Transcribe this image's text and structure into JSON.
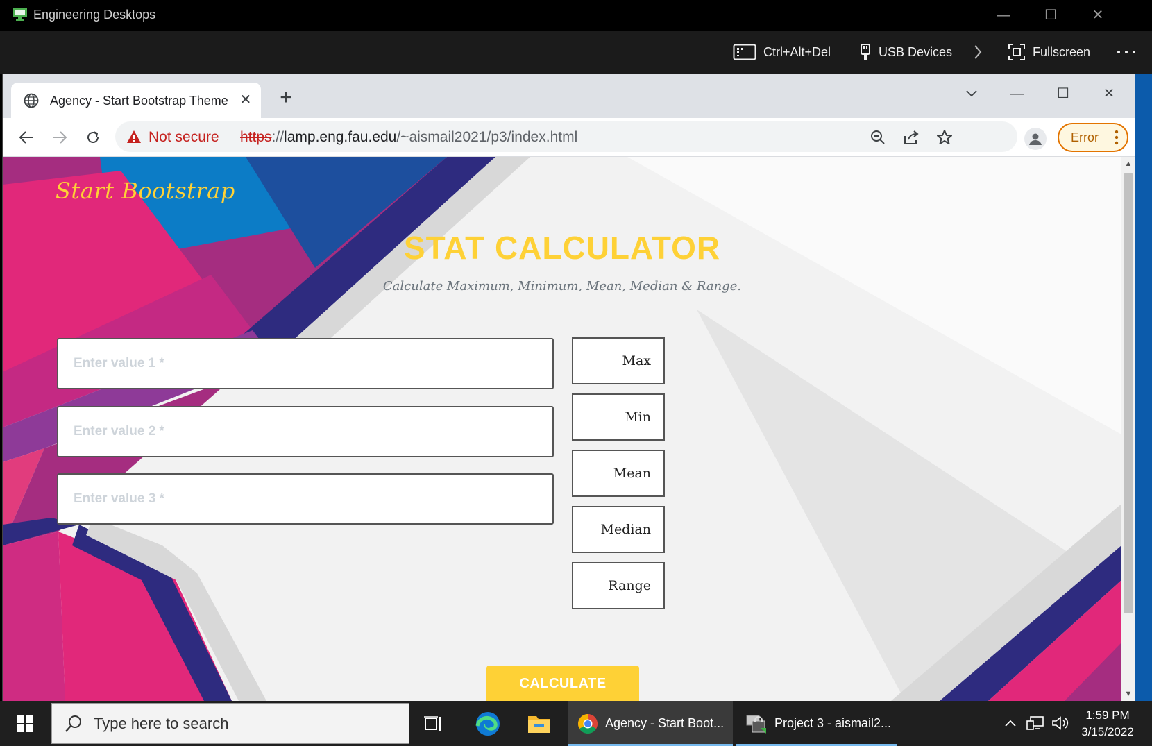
{
  "remote_window": {
    "title": "Engineering Desktops",
    "toolbar": {
      "ctrl_alt_del": "Ctrl+Alt+Del",
      "usb_devices": "USB Devices",
      "fullscreen": "Fullscreen"
    }
  },
  "browser": {
    "tab_title": "Agency - Start Bootstrap Theme",
    "security_label": "Not secure",
    "url_scheme": "https",
    "url_separator": "://",
    "url_host": "lamp.eng.fau.edu",
    "url_path": "/~aismail2021/p3/index.html",
    "error_label": "Error"
  },
  "page": {
    "brand": "Start Bootstrap",
    "title": "STAT CALCULATOR",
    "subtitle": "Calculate Maximum, Minimum, Mean, Median & Range.",
    "inputs": [
      {
        "placeholder": "Enter value 1 *",
        "value": ""
      },
      {
        "placeholder": "Enter value 2 *",
        "value": ""
      },
      {
        "placeholder": "Enter value 3 *",
        "value": ""
      }
    ],
    "stats": [
      {
        "label": "Max"
      },
      {
        "label": "Min"
      },
      {
        "label": "Mean"
      },
      {
        "label": "Median"
      },
      {
        "label": "Range"
      }
    ],
    "calculate_label": "CALCULATE"
  },
  "taskbar": {
    "search_placeholder": "Type here to search",
    "apps": [
      {
        "label": "Agency - Start Boot..."
      },
      {
        "label": "Project 3 - aismail2..."
      }
    ],
    "time": "1:59 PM",
    "date": "3/15/2022"
  },
  "colors": {
    "accent_yellow": "#fed136",
    "not_secure_red": "#c5221f",
    "error_orange": "#e37400"
  }
}
